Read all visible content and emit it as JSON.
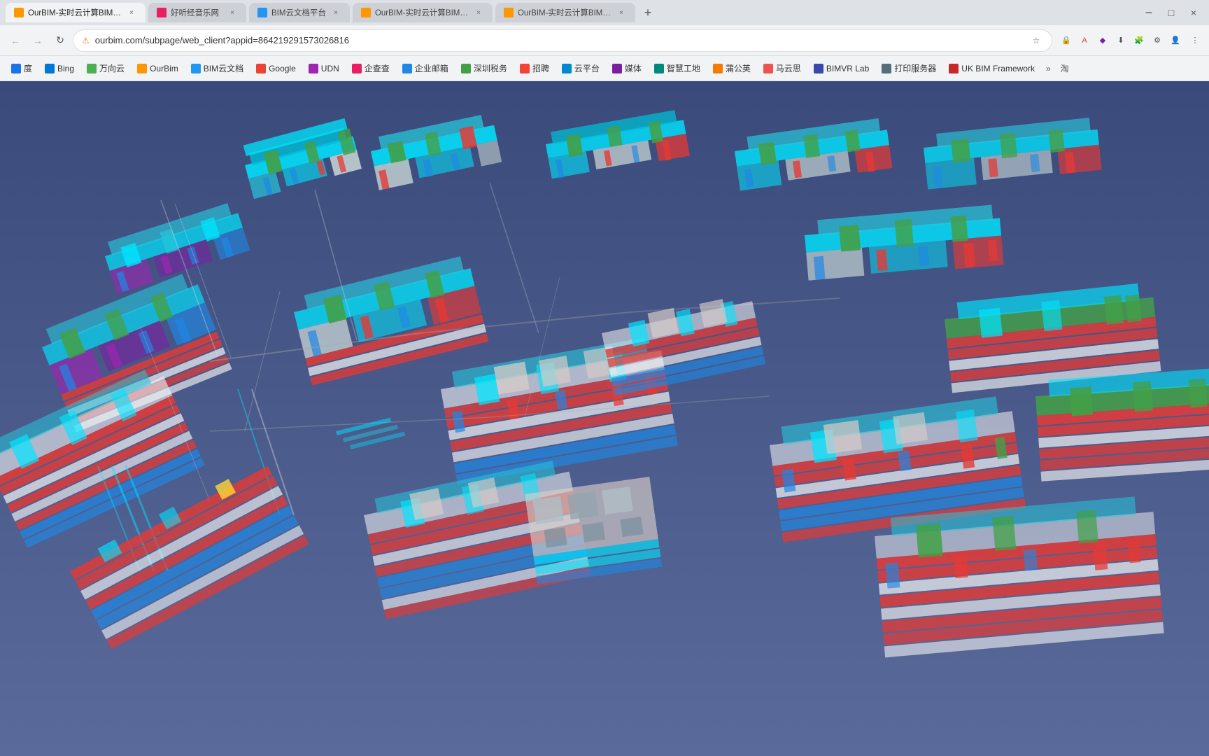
{
  "browser": {
    "tabs": [
      {
        "id": "tab1",
        "label": "好听经音乐网",
        "favicon_color": "#e91e63",
        "active": false,
        "closable": true
      },
      {
        "id": "tab2",
        "label": "BIM云文档平台",
        "favicon_color": "#2196f3",
        "active": false,
        "closable": true
      },
      {
        "id": "tab3",
        "label": "OurBIM-实时云计算BIM引擎平-",
        "favicon_color": "#ff9800",
        "active": false,
        "closable": true
      },
      {
        "id": "tab4",
        "label": "OurBIM-实时云计算BIM引擎平-",
        "favicon_color": "#ff9800",
        "active": false,
        "closable": true
      },
      {
        "id": "tab5",
        "label": "OurBIM-实时云计算BIM引擎平-",
        "favicon_color": "#ff9800",
        "active": true,
        "closable": true
      }
    ],
    "address": "ourbim.com/subpage/web_client?appid=864219291573026816",
    "security_warning": "不安全",
    "new_tab_label": "+"
  },
  "bookmarks": [
    {
      "id": "bm1",
      "label": "度",
      "favicon_color": "#1a73e8"
    },
    {
      "id": "bm2",
      "label": "Bing",
      "favicon_color": "#0078d7"
    },
    {
      "id": "bm3",
      "label": "万向云",
      "favicon_color": "#4caf50"
    },
    {
      "id": "bm4",
      "label": "OurBim",
      "favicon_color": "#ff9800"
    },
    {
      "id": "bm5",
      "label": "BIM云文档",
      "favicon_color": "#2196f3"
    },
    {
      "id": "bm6",
      "label": "Google",
      "favicon_color": "#ea4335"
    },
    {
      "id": "bm7",
      "label": "UDN",
      "favicon_color": "#9c27b0"
    },
    {
      "id": "bm8",
      "label": "企查查",
      "favicon_color": "#e91e63"
    },
    {
      "id": "bm9",
      "label": "企业邮箱",
      "favicon_color": "#1e88e5"
    },
    {
      "id": "bm10",
      "label": "深圳税务",
      "favicon_color": "#43a047"
    },
    {
      "id": "bm11",
      "label": "招聘",
      "favicon_color": "#f44336"
    },
    {
      "id": "bm12",
      "label": "云平台",
      "favicon_color": "#0288d1"
    },
    {
      "id": "bm13",
      "label": "媒体",
      "favicon_color": "#7b1fa2"
    },
    {
      "id": "bm14",
      "label": "智慧工地",
      "favicon_color": "#00897b"
    },
    {
      "id": "bm15",
      "label": "蒲公英",
      "favicon_color": "#f57c00"
    },
    {
      "id": "bm16",
      "label": "马云思",
      "favicon_color": "#ef5350"
    },
    {
      "id": "bm17",
      "label": "BIMVR Lab",
      "favicon_color": "#3949ab"
    },
    {
      "id": "bm18",
      "label": "打印服务器",
      "favicon_color": "#546e7a"
    },
    {
      "id": "bm19",
      "label": "UK BIM Framework",
      "favicon_color": "#c62828"
    }
  ],
  "viewport": {
    "type": "bim-3d-scene",
    "background_color": "#4a5a8a",
    "description": "3D BIM model of industrial facilities with piping systems"
  }
}
